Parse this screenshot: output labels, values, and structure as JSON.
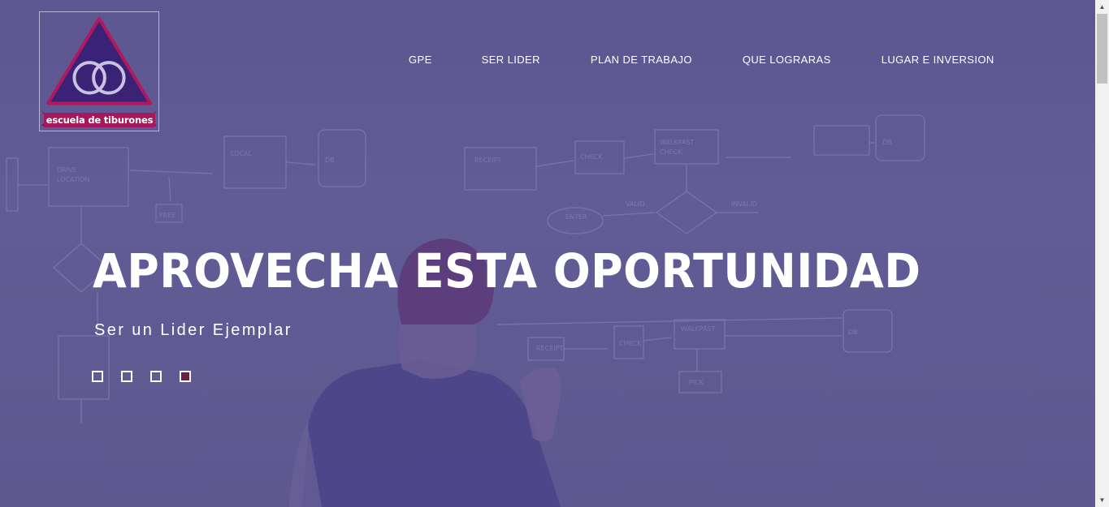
{
  "brand": {
    "logo_text": "escuela de tiburones"
  },
  "nav": {
    "items": [
      {
        "label": "GPE"
      },
      {
        "label": "SER LIDER"
      },
      {
        "label": "PLAN DE TRABAJO"
      },
      {
        "label": "QUE LOGRARAS"
      },
      {
        "label": "LUGAR E INVERSION"
      }
    ]
  },
  "hero": {
    "headline": "APROVECHA ESTA OPORTUNIDAD",
    "subline": "Ser un Lider Ejemplar",
    "slider": {
      "slide_count": 4,
      "active_index": 3
    }
  },
  "colors": {
    "overlay": "#5f5890",
    "active_dot": "#6b2046",
    "logo_triangle": "#3a2377",
    "logo_banner": "#a3195b"
  }
}
